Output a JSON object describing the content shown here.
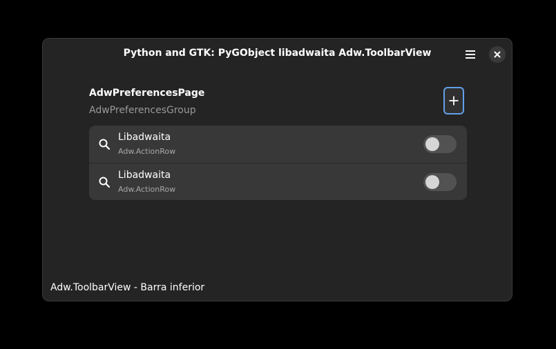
{
  "window": {
    "title": "Python and GTK: PyGObject libadwaita Adw.ToolbarView"
  },
  "header": {
    "menu_icon": "hamburger-menu-icon",
    "close_icon": "close-icon"
  },
  "preferences": {
    "page_title": "AdwPreferencesPage",
    "group_title": "AdwPreferencesGroup",
    "add_icon": "plus-icon",
    "rows": [
      {
        "title": "Libadwaita",
        "subtitle": "Adw.ActionRow",
        "icon": "search-icon",
        "switch_on": false
      },
      {
        "title": "Libadwaita",
        "subtitle": "Adw.ActionRow",
        "icon": "search-icon",
        "switch_on": false
      }
    ]
  },
  "bottom_bar": {
    "label": "Adw.ToolbarView - Barra inferior"
  },
  "colors": {
    "window_bg": "#242424",
    "list_bg": "#383838",
    "accent": "#62a0ea"
  }
}
